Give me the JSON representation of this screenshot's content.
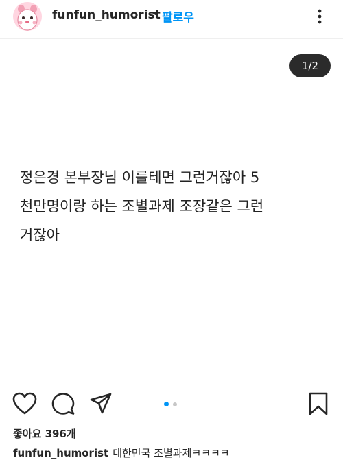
{
  "header": {
    "username": "funfun_humorist",
    "separator": "•",
    "follow_label": "팔로우",
    "avatar_icon": "hamster-avatar-icon",
    "more_icon": "more-vertical-icon"
  },
  "carousel": {
    "counter": "1/2",
    "current_slide": 1,
    "total_slides": 2
  },
  "post": {
    "lines": [
      "정은경 본부장님 이를테면 그런거잖아 5",
      "천만명이랑 하는 조별과제 조장같은 그런",
      "거잖아"
    ]
  },
  "actions": {
    "like_icon": "heart-icon",
    "comment_icon": "comment-icon",
    "share_icon": "send-icon",
    "save_icon": "bookmark-icon"
  },
  "footer": {
    "likes": "좋아요 396개",
    "caption_user": "funfun_humorist",
    "caption_text": "대한민국 조별과제ㅋㅋㅋㅋ"
  },
  "colors": {
    "accent": "#0095f6",
    "counter_bg": "#2b2b2b",
    "dot_active": "#0095f6",
    "dot_inactive": "#c7c7c7"
  }
}
